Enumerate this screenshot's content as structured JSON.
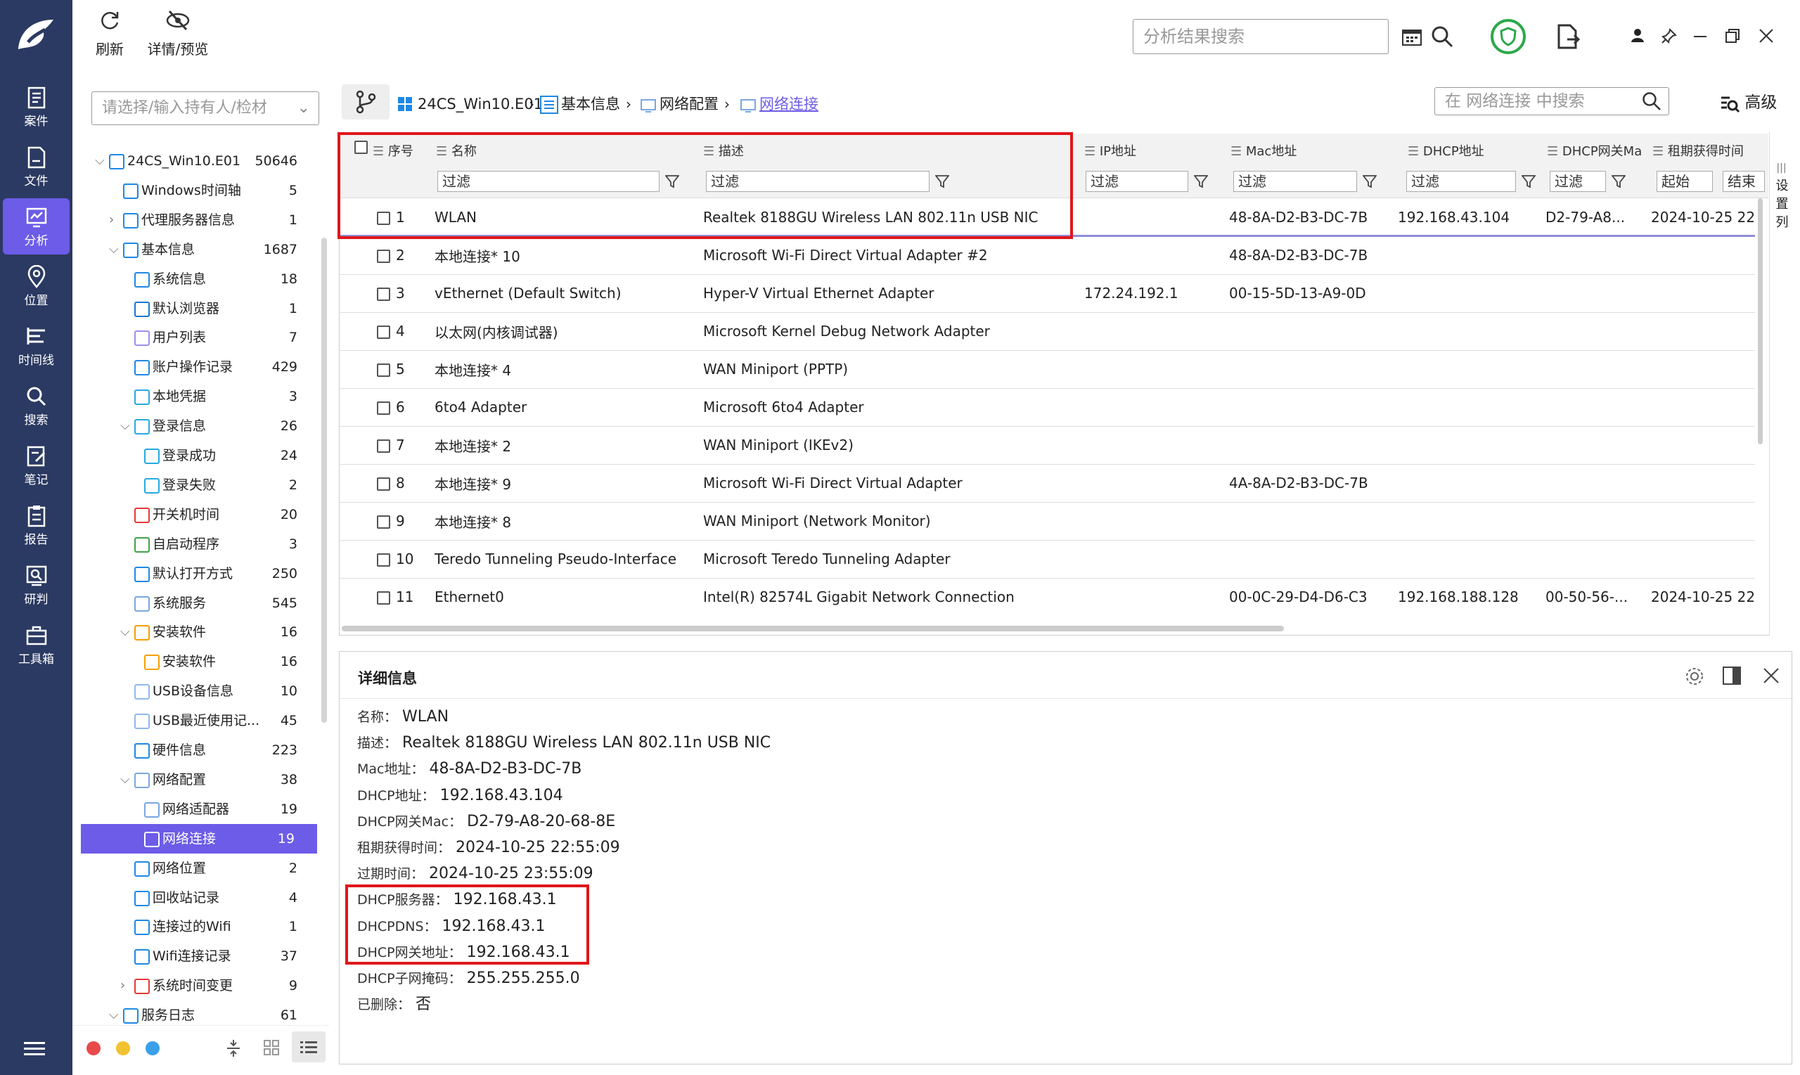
{
  "toolbar": {
    "refresh": "刷新",
    "detail_preview": "详情/预览",
    "search_placeholder": "分析结果搜索"
  },
  "nav": [
    {
      "label": "案件",
      "icon": "case-icon"
    },
    {
      "label": "文件",
      "icon": "file-icon"
    },
    {
      "label": "分析",
      "icon": "analysis-icon",
      "active": true
    },
    {
      "label": "位置",
      "icon": "location-icon"
    },
    {
      "label": "时间线",
      "icon": "timeline-icon"
    },
    {
      "label": "搜索",
      "icon": "search-icon"
    },
    {
      "label": "笔记",
      "icon": "note-icon"
    },
    {
      "label": "报告",
      "icon": "report-icon"
    },
    {
      "label": "研判",
      "icon": "judge-icon"
    },
    {
      "label": "工具箱",
      "icon": "toolbox-icon"
    }
  ],
  "holder_placeholder": "请选择/输入持有人/检材",
  "tree": [
    {
      "label": "24CS_Win10.E01",
      "count": "50646",
      "level": 0,
      "caret": "v",
      "color": "#1e88e5"
    },
    {
      "label": "Windows时间轴",
      "count": "5",
      "level": 1,
      "caret": "",
      "color": "#1e88e5"
    },
    {
      "label": "代理服务器信息",
      "count": "1",
      "level": 1,
      "caret": ">",
      "color": "#1e88e5"
    },
    {
      "label": "基本信息",
      "count": "1687",
      "level": 1,
      "caret": "v",
      "color": "#1e88e5"
    },
    {
      "label": "系统信息",
      "count": "18",
      "level": 2,
      "caret": "",
      "color": "#1e88e5"
    },
    {
      "label": "默认浏览器",
      "count": "1",
      "level": 2,
      "caret": "",
      "color": "#1976d2"
    },
    {
      "label": "用户列表",
      "count": "7",
      "level": 2,
      "caret": "",
      "color": "#9c8ff0"
    },
    {
      "label": "账户操作记录",
      "count": "429",
      "level": 2,
      "caret": "",
      "color": "#1e88e5"
    },
    {
      "label": "本地凭据",
      "count": "3",
      "level": 2,
      "caret": "",
      "color": "#26a9e0"
    },
    {
      "label": "登录信息",
      "count": "26",
      "level": 2,
      "caret": "v",
      "color": "#26a9e0"
    },
    {
      "label": "登录成功",
      "count": "24",
      "level": 3,
      "caret": "",
      "color": "#26a9e0"
    },
    {
      "label": "登录失败",
      "count": "2",
      "level": 3,
      "caret": "",
      "color": "#26a9e0"
    },
    {
      "label": "开关机时间",
      "count": "20",
      "level": 2,
      "caret": "",
      "color": "#e53935"
    },
    {
      "label": "自启动程序",
      "count": "3",
      "level": 2,
      "caret": "",
      "color": "#43a047"
    },
    {
      "label": "默认打开方式",
      "count": "250",
      "level": 2,
      "caret": "",
      "color": "#1e88e5"
    },
    {
      "label": "系统服务",
      "count": "545",
      "level": 2,
      "caret": "",
      "color": "#7aa7e0"
    },
    {
      "label": "安装软件",
      "count": "16",
      "level": 2,
      "caret": "v",
      "color": "#f4a000"
    },
    {
      "label": "安装软件",
      "count": "16",
      "level": 3,
      "caret": "",
      "color": "#f4a000"
    },
    {
      "label": "USB设备信息",
      "count": "10",
      "level": 2,
      "caret": "",
      "color": "#90b8f0"
    },
    {
      "label": "USB最近使用记...",
      "count": "45",
      "level": 2,
      "caret": "",
      "color": "#90b8f0"
    },
    {
      "label": "硬件信息",
      "count": "223",
      "level": 2,
      "caret": "",
      "color": "#1e88e5"
    },
    {
      "label": "网络配置",
      "count": "38",
      "level": 2,
      "caret": "v",
      "color": "#7aa7e0"
    },
    {
      "label": "网络适配器",
      "count": "19",
      "level": 3,
      "caret": "",
      "color": "#7aa7e0"
    },
    {
      "label": "网络连接",
      "count": "19",
      "level": 3,
      "caret": "",
      "color": "#ffffff",
      "selected": true
    },
    {
      "label": "网络位置",
      "count": "2",
      "level": 2,
      "caret": "",
      "color": "#1e88e5"
    },
    {
      "label": "回收站记录",
      "count": "4",
      "level": 2,
      "caret": "",
      "color": "#1e88e5"
    },
    {
      "label": "连接过的Wifi",
      "count": "1",
      "level": 2,
      "caret": "",
      "color": "#1e88e5"
    },
    {
      "label": "Wifi连接记录",
      "count": "37",
      "level": 2,
      "caret": "",
      "color": "#1e88e5"
    },
    {
      "label": "系统时间变更",
      "count": "9",
      "level": 2,
      "caret": ">",
      "color": "#e53935"
    },
    {
      "label": "服务日志",
      "count": "61",
      "level": 1,
      "caret": "v",
      "color": "#1e88e5"
    }
  ],
  "breadcrumb": [
    "24CS_Win10.E01",
    "基本信息",
    "网络配置",
    "网络连接"
  ],
  "table_search_placeholder": "在 网络连接 中搜索",
  "advanced": "高级",
  "settings_col": "设置列",
  "filter_placeholder": "过滤",
  "filter_start": "起始",
  "filter_end": "结束",
  "columns": [
    "序号",
    "名称",
    "描述",
    "IP地址",
    "Mac地址",
    "DHCP地址",
    "DHCP网关Ma",
    "租期获得时间"
  ],
  "rows": [
    [
      "1",
      "WLAN",
      "Realtek 8188GU Wireless LAN 802.11n USB NIC",
      "",
      "48-8A-D2-B3-DC-7B",
      "192.168.43.104",
      "D2-79-A8...",
      "2024-10-25 22"
    ],
    [
      "2",
      "本地连接* 10",
      "Microsoft Wi-Fi Direct Virtual Adapter #2",
      "",
      "48-8A-D2-B3-DC-7B",
      "",
      "",
      ""
    ],
    [
      "3",
      "vEthernet (Default Switch)",
      "Hyper-V Virtual Ethernet Adapter",
      "172.24.192.1",
      "00-15-5D-13-A9-0D",
      "",
      "",
      ""
    ],
    [
      "4",
      "以太网(内核调试器)",
      "Microsoft Kernel Debug Network Adapter",
      "",
      "",
      "",
      "",
      ""
    ],
    [
      "5",
      "本地连接* 4",
      "WAN Miniport (PPTP)",
      "",
      "",
      "",
      "",
      ""
    ],
    [
      "6",
      "6to4 Adapter",
      "Microsoft 6to4 Adapter",
      "",
      "",
      "",
      "",
      ""
    ],
    [
      "7",
      "本地连接* 2",
      "WAN Miniport (IKEv2)",
      "",
      "",
      "",
      "",
      ""
    ],
    [
      "8",
      "本地连接* 9",
      "Microsoft Wi-Fi Direct Virtual Adapter",
      "",
      "4A-8A-D2-B3-DC-7B",
      "",
      "",
      ""
    ],
    [
      "9",
      "本地连接* 8",
      "WAN Miniport (Network Monitor)",
      "",
      "",
      "",
      "",
      ""
    ],
    [
      "10",
      "Teredo Tunneling Pseudo-Interface",
      "Microsoft Teredo Tunneling Adapter",
      "",
      "",
      "",
      "",
      ""
    ],
    [
      "11",
      "Ethernet0",
      "Intel(R) 82574L Gigabit Network Connection",
      "",
      "00-0C-29-D4-D6-C3",
      "192.168.188.128",
      "00-50-56-...",
      "2024-10-25 22"
    ]
  ],
  "detail": {
    "title": "详细信息",
    "fields": [
      {
        "k": "名称：",
        "v": "WLAN"
      },
      {
        "k": "描述：",
        "v": "Realtek 8188GU Wireless LAN 802.11n USB NIC"
      },
      {
        "k": "Mac地址：",
        "v": "48-8A-D2-B3-DC-7B"
      },
      {
        "k": "DHCP地址：",
        "v": "192.168.43.104"
      },
      {
        "k": "DHCP网关Mac：",
        "v": "D2-79-A8-20-68-8E"
      },
      {
        "k": "租期获得时间：",
        "v": "2024-10-25 22:55:09"
      },
      {
        "k": "过期时间：",
        "v": "2024-10-25 23:55:09"
      },
      {
        "k": "DHCP服务器：",
        "v": "192.168.43.1"
      },
      {
        "k": "DHCPDNS：",
        "v": "192.168.43.1"
      },
      {
        "k": "DHCP网关地址：",
        "v": "192.168.43.1"
      },
      {
        "k": "DHCP子网掩码：",
        "v": "255.255.255.0"
      },
      {
        "k": "已删除：",
        "v": "否"
      }
    ]
  },
  "colors": {
    "nav_bg": "#2b3a62",
    "accent": "#6c5ce7",
    "highlight": "#e0161b",
    "shield": "#2ea84a"
  }
}
